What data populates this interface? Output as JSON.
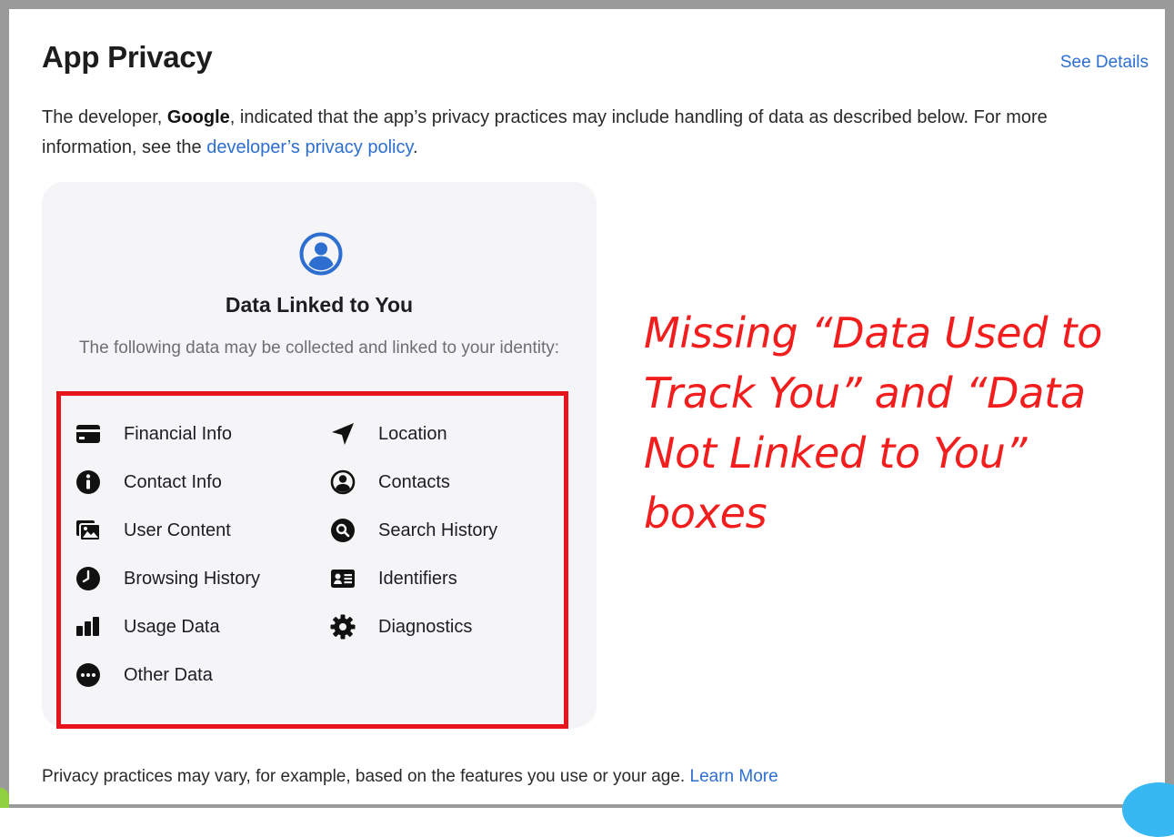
{
  "header": {
    "title": "App Privacy",
    "see_details": "See Details"
  },
  "description": {
    "prefix": "The developer, ",
    "developer": "Google",
    "middle": ", indicated that the app’s privacy practices may include handling of data as described below. For more information, see the ",
    "link": "developer’s privacy policy",
    "suffix": "."
  },
  "card": {
    "icon": "person-circle-icon",
    "title": "Data Linked to You",
    "subtitle": "The following data may be collected and linked to your identity:",
    "items": [
      {
        "label": "Financial Info",
        "icon": "credit-card-icon"
      },
      {
        "label": "Location",
        "icon": "location-arrow-icon"
      },
      {
        "label": "Contact Info",
        "icon": "info-circle-icon"
      },
      {
        "label": "Contacts",
        "icon": "person-circle-icon"
      },
      {
        "label": "User Content",
        "icon": "photos-icon"
      },
      {
        "label": "Search History",
        "icon": "magnifier-circle-icon"
      },
      {
        "label": "Browsing History",
        "icon": "clock-icon"
      },
      {
        "label": "Identifiers",
        "icon": "id-card-icon"
      },
      {
        "label": "Usage Data",
        "icon": "bar-chart-icon"
      },
      {
        "label": "Diagnostics",
        "icon": "gear-icon"
      },
      {
        "label": "Other Data",
        "icon": "ellipsis-circle-icon"
      }
    ]
  },
  "annotation": {
    "text": "Missing “Data Used to Track You” and “Data Not Linked to You” boxes",
    "color": "#f21d1d"
  },
  "footer": {
    "text": "Privacy practices may vary, for example, based on the features you use or your age. ",
    "link": "Learn More"
  },
  "colors": {
    "link": "#2d6fd0",
    "highlight": "#e8141b",
    "card_bg": "#f5f5f7"
  }
}
